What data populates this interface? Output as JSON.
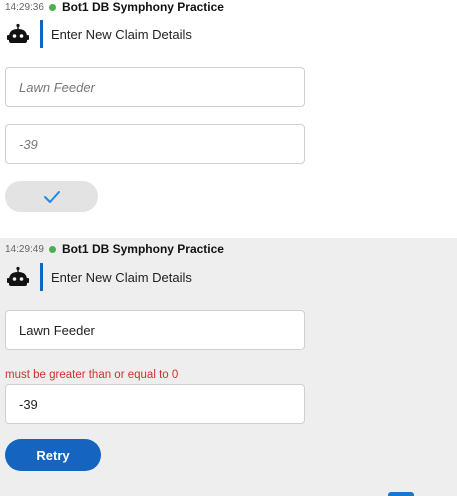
{
  "messages": [
    {
      "timestamp": "14:29:36",
      "sender": "Bot1 DB Symphony Practice",
      "prompt": "Enter New Claim Details",
      "fields": [
        {
          "value": "Lawn Feeder"
        },
        {
          "value": "-39"
        }
      ],
      "submit_icon": "checkmark-icon"
    },
    {
      "timestamp": "14:29:49",
      "sender": "Bot1 DB Symphony Practice",
      "prompt": "Enter New Claim Details",
      "fields": [
        {
          "value": "Lawn Feeder"
        },
        {
          "value": "-39",
          "error": "must be greater than or equal to 0"
        }
      ],
      "retry_label": "Retry"
    }
  ],
  "colors": {
    "accent": "#1565c0",
    "status_online": "#4caf50",
    "error": "#d32f2f"
  },
  "icons": {
    "avatar": "robot-icon",
    "status": "online-dot-icon"
  }
}
